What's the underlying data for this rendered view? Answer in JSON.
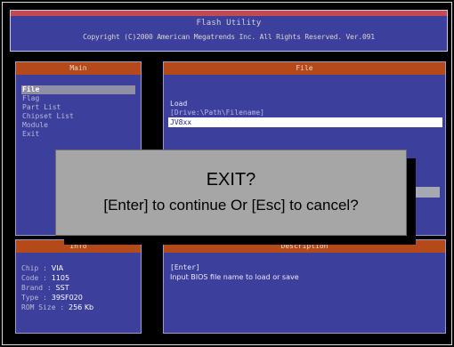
{
  "header": {
    "title": "Flash Utility",
    "copyright": "Copyright (C)2000 American Megatrends Inc. All Rights Reserved. Ver.091"
  },
  "main_panel": {
    "title": "Main",
    "items": [
      "File",
      "Flag",
      "Part List",
      "Chipset List",
      "Module",
      "Exit"
    ],
    "selected": "File"
  },
  "file_panel": {
    "title": "File",
    "load_label": "Load",
    "path_hint": "[Drive:\\Path\\Filename]",
    "input_value": "JV8xx"
  },
  "info_panel": {
    "title": "Info",
    "rows": [
      {
        "label": "Chip   :",
        "value": "VIA"
      },
      {
        "label": "Code   :",
        "value": "1105"
      },
      {
        "label": "Brand  :",
        "value": "SST"
      },
      {
        "label": "Type   :",
        "value": "39SF020"
      },
      {
        "label": "ROM Size :",
        "value": "256 Kb"
      }
    ]
  },
  "help_panel": {
    "title": "Description",
    "line1": "[Enter]",
    "line2": "Input BIOS file name to load or save"
  },
  "dialog": {
    "question": "EXIT?",
    "message": "[Enter] to continue Or [Esc] to cancel?"
  },
  "colors": {
    "panel_bg": "#3d3f9c",
    "title_strip": "#b44a1a",
    "dialog_bg": "#a6a6a6"
  }
}
